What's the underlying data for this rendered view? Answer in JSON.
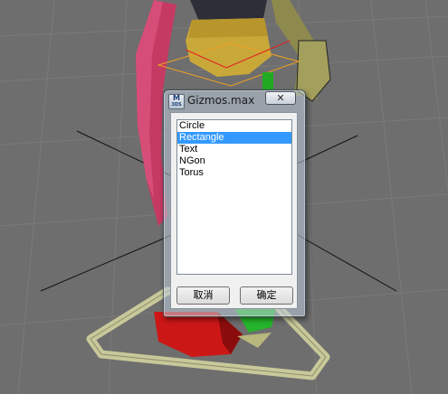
{
  "dialog": {
    "title": "Gizmos.max",
    "icon_text": "M",
    "icon_subtext": "3DS",
    "close_glyph": "✕"
  },
  "listbox": {
    "items": [
      {
        "label": "Circle",
        "selected": false
      },
      {
        "label": "Rectangle",
        "selected": true
      },
      {
        "label": "Text",
        "selected": false
      },
      {
        "label": "NGon",
        "selected": false
      },
      {
        "label": "Torus",
        "selected": false
      }
    ]
  },
  "buttons": {
    "cancel_label": "取消",
    "ok_label": "确定"
  },
  "colors": {
    "selection": "#3399ff",
    "viewport_bg": "#6d6d6d"
  }
}
